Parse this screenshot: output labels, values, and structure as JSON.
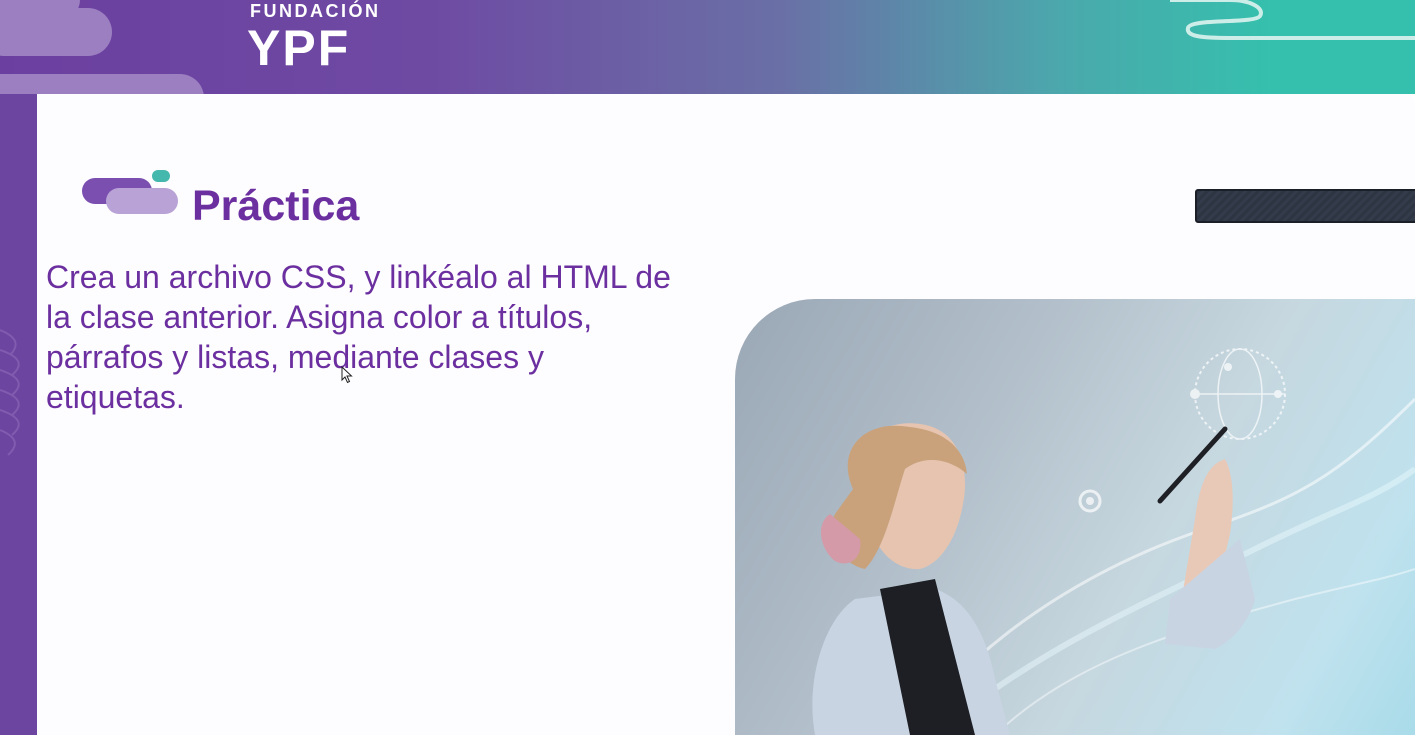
{
  "header": {
    "logo_top": "FUNDACIÓN",
    "logo_main": "YPF"
  },
  "slide": {
    "title": "Práctica",
    "body": "Crea un archivo CSS, y linkéalo al HTML de la clase anterior. Asigna color a títulos, párrafos y listas, mediante clases y etiquetas."
  },
  "colors": {
    "accent_purple": "#6b2fa0",
    "teal": "#35c0ad",
    "lavender": "#9c7fc1"
  },
  "icons": {
    "title_decoration": "cloud-pills-icon",
    "cursor": "mouse-pointer-icon"
  }
}
